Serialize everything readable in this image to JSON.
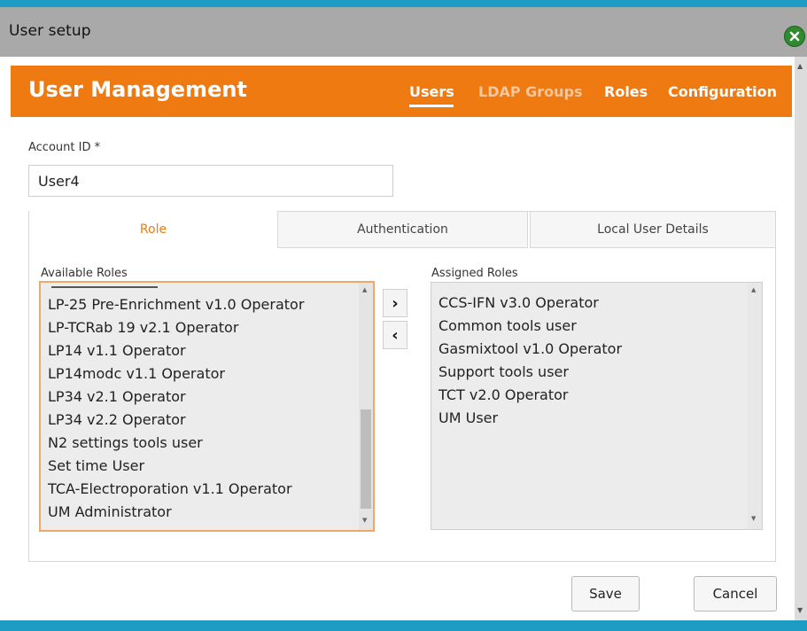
{
  "window": {
    "title": "User setup"
  },
  "header": {
    "title": "User Management",
    "nav": [
      {
        "label": "Users",
        "active": true
      },
      {
        "label": "LDAP Groups",
        "active": false
      },
      {
        "label": "Roles",
        "active": false
      },
      {
        "label": "Configuration",
        "active": false
      }
    ]
  },
  "account": {
    "label": "Account ID *",
    "value": "User4"
  },
  "tabs": [
    {
      "label": "Role",
      "active": true
    },
    {
      "label": "Authentication",
      "active": false
    },
    {
      "label": "Local User Details",
      "active": false
    }
  ],
  "available_roles": {
    "label": "Available Roles",
    "items": [
      "LP-25 Pre-Enrichment v1.0 Operator",
      "LP-TCRab 19 v2.1 Operator",
      "LP14 v1.1 Operator",
      "LP14modc v1.1 Operator",
      "LP34 v2.1 Operator",
      "LP34 v2.2 Operator",
      "N2 settings tools user",
      "Set time User",
      "TCA-Electroporation v1.1 Operator",
      "UM Administrator"
    ]
  },
  "assigned_roles": {
    "label": "Assigned Roles",
    "items": [
      "CCS-IFN v3.0 Operator",
      "Common tools user",
      "Gasmixtool v1.0 Operator",
      "Support tools user",
      "TCT v2.0 Operator",
      "UM User"
    ]
  },
  "move_buttons": {
    "add": "›",
    "remove": "‹"
  },
  "footer": {
    "save": "Save",
    "cancel": "Cancel"
  },
  "colors": {
    "accent": "#ef7a11",
    "titlebar": "#a9a9a9",
    "frame": "#1e9cc4"
  }
}
